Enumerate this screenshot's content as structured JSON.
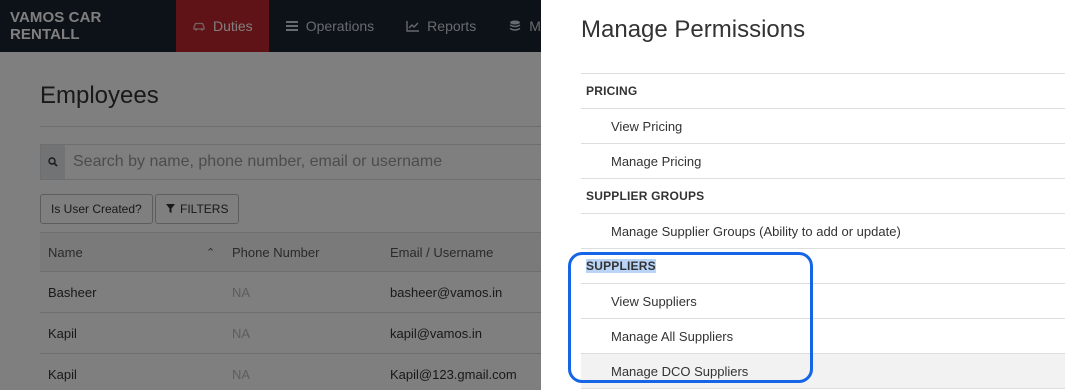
{
  "nav": {
    "brand": "VAMOS CAR RENTALL",
    "items": [
      {
        "label": "Duties",
        "icon": "car-icon",
        "active": true
      },
      {
        "label": "Operations",
        "icon": "list-icon",
        "active": false
      },
      {
        "label": "Reports",
        "icon": "chart-icon",
        "active": false
      },
      {
        "label": "Maste",
        "icon": "database-icon",
        "active": false
      }
    ]
  },
  "page": {
    "title": "Employees",
    "search_placeholder": "Search by name, phone number, email or username",
    "filter_is_user_created": "Is User Created?",
    "filters_label": "FILTERS",
    "table": {
      "columns": [
        "Name",
        "Phone Number",
        "Email / Username"
      ],
      "rows": [
        {
          "name": "Basheer",
          "phone": "NA",
          "email": "basheer@vamos.in"
        },
        {
          "name": "Kapil",
          "phone": "NA",
          "email": "kapil@vamos.in"
        },
        {
          "name": "Kapil",
          "phone": "NA",
          "email": "Kapil@123.gmail.com"
        }
      ]
    }
  },
  "drawer": {
    "title": "Manage Permissions",
    "groups": [
      {
        "label": "PRICING",
        "items": [
          "View Pricing",
          "Manage Pricing"
        ]
      },
      {
        "label": "SUPPLIER GROUPS",
        "items": [
          "Manage Supplier Groups (Ability to add or update)"
        ]
      },
      {
        "label": "SUPPLIERS",
        "items": [
          "View Suppliers",
          "Manage All Suppliers",
          "Manage DCO Suppliers"
        ]
      }
    ]
  },
  "colors": {
    "nav_bg": "#1b2531",
    "nav_active": "#c0262c",
    "annotation": "#1565e6",
    "text_selection": "#b9d4f7"
  }
}
